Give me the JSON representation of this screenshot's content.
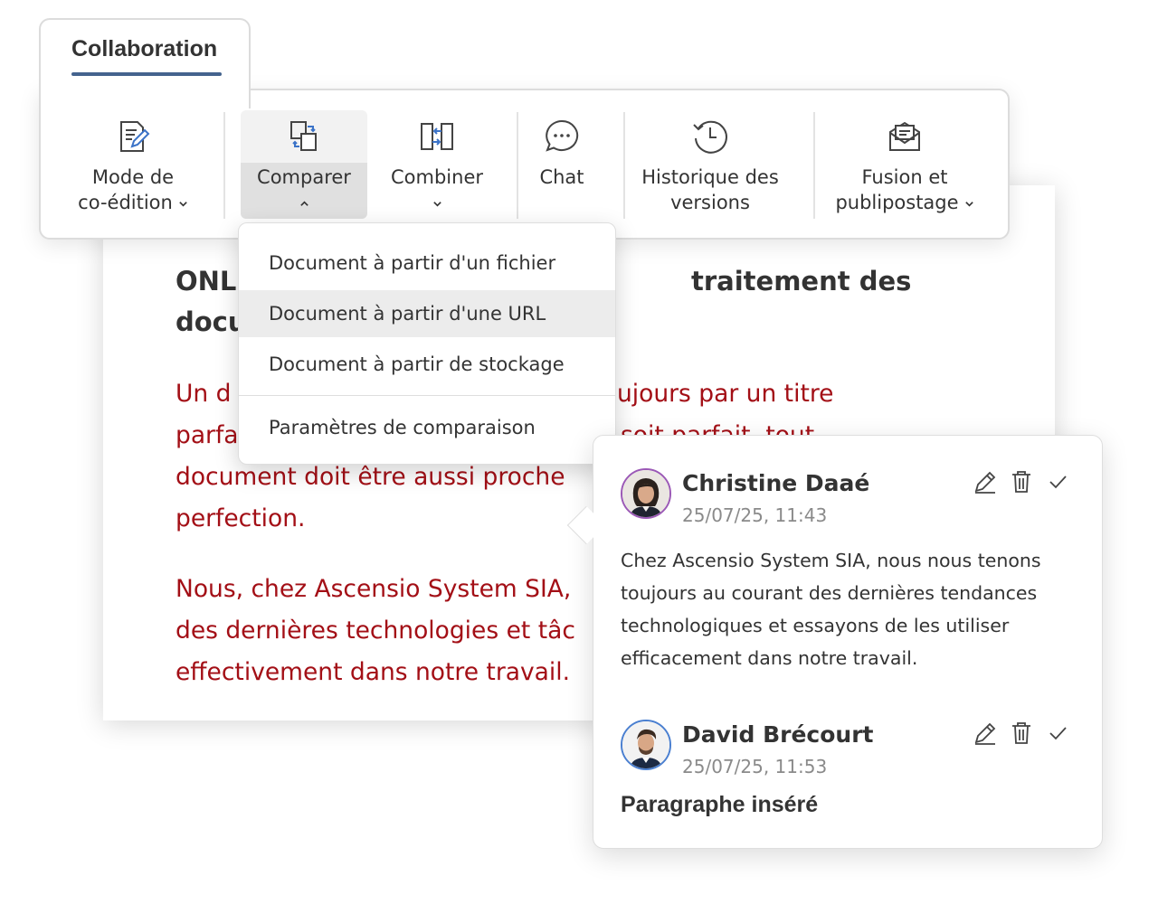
{
  "ribbon": {
    "active_tab": "Collaboration",
    "accent_color": "#44638e",
    "items": [
      {
        "id": "coedit",
        "line1": "Mode de",
        "line2": "co-édition",
        "icon": "coedit-icon",
        "caret": "chevron-down-icon"
      },
      {
        "id": "compare",
        "line1": "Comparer",
        "icon": "compare-icon",
        "caret": "chevron-up-icon"
      },
      {
        "id": "combine",
        "line1": "Combiner",
        "icon": "combine-icon",
        "caret": "chevron-down-icon"
      },
      {
        "id": "chat",
        "line1": "Chat",
        "icon": "chat-icon"
      },
      {
        "id": "history",
        "line1": "Historique des",
        "line2": "versions",
        "icon": "history-icon"
      },
      {
        "id": "mailmerge",
        "line1": "Fusion et",
        "line2": "publipostage",
        "icon": "mail-merge-icon",
        "caret": "chevron-down-icon"
      }
    ]
  },
  "compare_menu": {
    "items": [
      "Document à partir d'un fichier",
      "Document à partir d'une URL",
      "Document à partir de stockage",
      "Paramètres de comparaison"
    ],
    "hovered_index": 1
  },
  "document": {
    "title_left_1": "ONL",
    "title_right_1": "traitement des",
    "title_left_2": "docu",
    "deleted_lines": [
      {
        "left": "Un d",
        "right": "ujours par un titre"
      },
      {
        "left": "parfa",
        "right": "soit parfait, tout"
      },
      {
        "left": "document doit être aussi proche",
        "right": ""
      },
      {
        "left": "perfection.",
        "right": ""
      }
    ],
    "inserted_lines": [
      "Nous, chez Ascensio System SIA,",
      "des dernières technologies et tâc",
      "effectivement dans notre travail."
    ],
    "change_color": "#a30f16"
  },
  "comments": [
    {
      "author": "Christine Daaé",
      "date": "25/07/25, 11:43",
      "text": "Chez Ascensio System SIA, nous nous tenons toujours au courant des dernières tendances technologiques et essayons de les utiliser efficacement dans notre travail.",
      "avatar_border": "#9b59b6"
    },
    {
      "author": "David Brécourt",
      "date": "25/07/25, 11:53",
      "text": "Paragraphe inséré",
      "avatar_border": "#4a7fd0"
    }
  ]
}
